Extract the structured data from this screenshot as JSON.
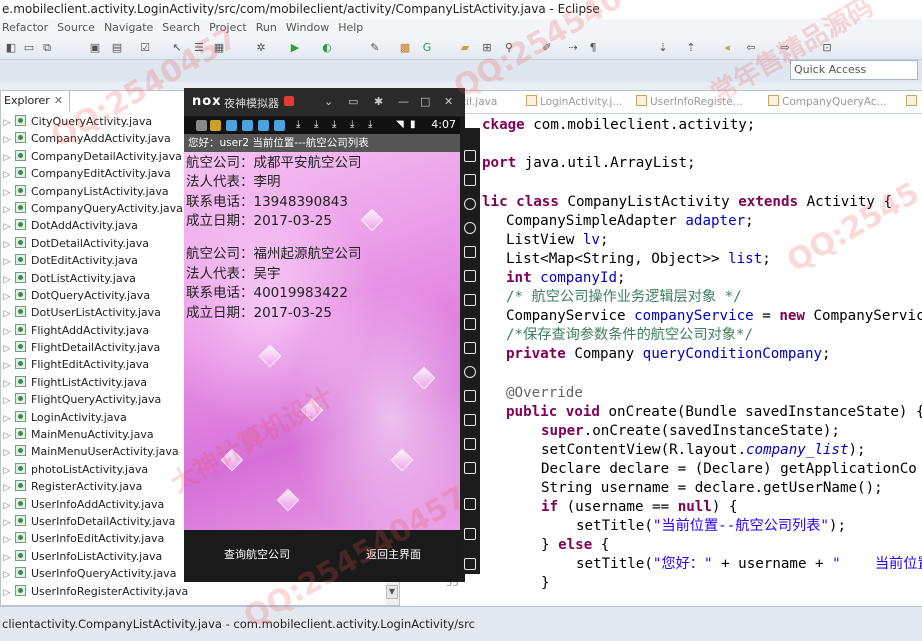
{
  "window": {
    "title": "e.mobileclient.activity.LoginActivity/src/com/mobileclient/activity/CompanyListActivity.java - Eclipse"
  },
  "menu": [
    "Refactor",
    "Source",
    "Navigate",
    "Search",
    "Project",
    "Run",
    "Window",
    "Help"
  ],
  "quick_access": {
    "placeholder": "Quick Access"
  },
  "explorer": {
    "tab_label": "Explorer",
    "files": [
      "CityQueryActivity.java",
      "CompanyAddActivity.java",
      "CompanyDetailActivity.java",
      "CompanyEditActivity.java",
      "CompanyListActivity.java",
      "CompanyQueryActivity.java",
      "DotAddActivity.java",
      "DotDetailActivity.java",
      "DotEditActivity.java",
      "DotListActivity.java",
      "DotQueryActivity.java",
      "DotUserListActivity.java",
      "FlightAddActivity.java",
      "FlightDetailActivity.java",
      "FlightEditActivity.java",
      "FlightListActivity.java",
      "FlightQueryActivity.java",
      "LoginActivity.java",
      "MainMenuActivity.java",
      "MainMenuUserActivity.java",
      "photoListActivity.java",
      "RegisterActivity.java",
      "UserInfoAddActivity.java",
      "UserInfoDetailActivity.java",
      "UserInfoEditActivity.java",
      "UserInfoListActivity.java",
      "UserInfoQueryActivity.java",
      "UserInfoRegisterActivity.java"
    ]
  },
  "editor": {
    "tabs": [
      "til.java",
      "LoginActivity.j...",
      "UserInfoRegiste...",
      "CompanyQueryAc..."
    ],
    "line_number_visible": "55"
  },
  "emulator": {
    "brand": "nox",
    "name": "夜神模拟器",
    "clock": "4:07",
    "appbar_title": "您好：user2  当前位置---航空公司列表",
    "records": [
      {
        "company": "航空公司：成都平安航空公司",
        "legal": "法人代表：李明",
        "phone": "联系电话：13948390843",
        "date": "成立日期：2017-03-25"
      },
      {
        "company": "航空公司：福州起源航空公司",
        "legal": "法人代表：吴宇",
        "phone": "联系电话：40019983422",
        "date": "成立日期：2017-03-25"
      }
    ],
    "bottom_left": "查询航空公司",
    "bottom_right": "返回主界面"
  },
  "status": {
    "text": "clientactivity.CompanyListActivity.java - com.mobileclient.activity.LoginActivity/src"
  },
  "watermarks": [
    "QQ:2540457",
    "QQ:254540457",
    "常年售精品源码",
    "大神计算机设计",
    "QQ:2545"
  ]
}
